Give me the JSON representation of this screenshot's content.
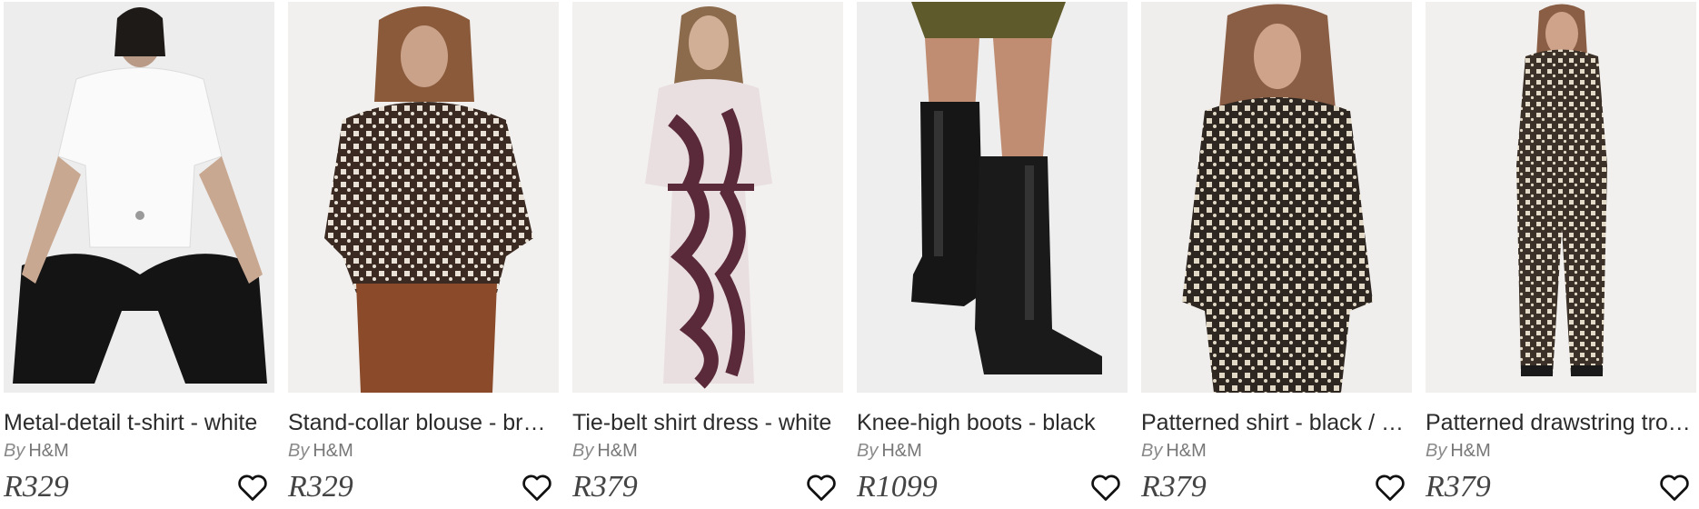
{
  "products": [
    {
      "title": "Metal-detail t-shirt - white",
      "by": "By",
      "brand": "H&M",
      "price": "R329",
      "image": "model-white-tshirt"
    },
    {
      "title": "Stand-collar blouse - brown",
      "by": "By",
      "brand": "H&M",
      "price": "R329",
      "image": "model-patterned-blouse"
    },
    {
      "title": "Tie-belt shirt dress - white",
      "by": "By",
      "brand": "H&M",
      "price": "R379",
      "image": "model-swirl-dress"
    },
    {
      "title": "Knee-high boots - black",
      "by": "By",
      "brand": "H&M",
      "price": "R1099",
      "image": "black-knee-boots"
    },
    {
      "title": "Patterned shirt - black / beige",
      "by": "By",
      "brand": "H&M",
      "price": "R379",
      "image": "model-patterned-shirt"
    },
    {
      "title": "Patterned drawstring trousers",
      "by": "By",
      "brand": "H&M",
      "price": "R379",
      "image": "model-patterned-trousers"
    }
  ],
  "icons": {
    "wishlist": "heart-outline-icon"
  },
  "colors": {
    "text": "#2b2b2b",
    "muted": "#777777",
    "price": "#444444"
  }
}
